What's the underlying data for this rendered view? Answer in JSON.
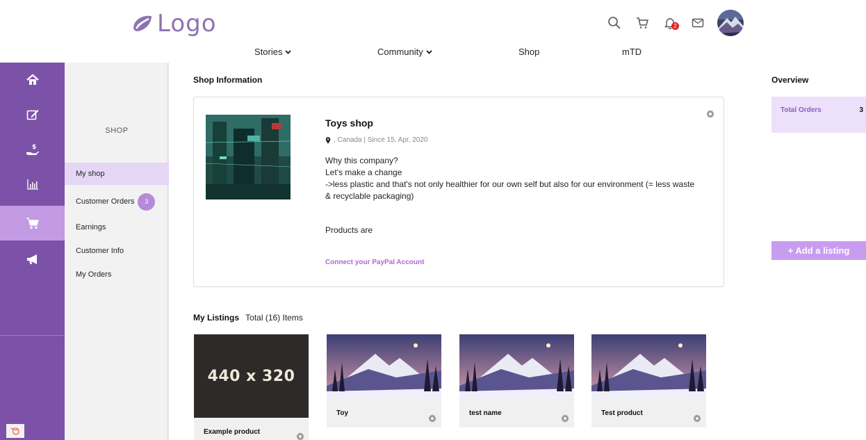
{
  "header": {
    "logo_text": "Logo",
    "notifications_count": "2",
    "icons": [
      "search-icon",
      "cart-icon",
      "bell-icon",
      "mail-icon"
    ]
  },
  "nav": {
    "stories": "Stories",
    "community": "Community",
    "shop": "Shop",
    "mtd": "mTD"
  },
  "rail": {
    "icons": [
      "home-icon",
      "edit-icon",
      "hand-money-icon",
      "chart-icon",
      "cart-icon",
      "megaphone-icon"
    ],
    "active": "cart-icon"
  },
  "sidebar": {
    "title": "SHOP",
    "items": [
      {
        "label": "My shop"
      },
      {
        "label": "Customer Orders",
        "count": "3"
      },
      {
        "label": "Earnings"
      },
      {
        "label": "Customer Info"
      },
      {
        "label": "My Orders"
      }
    ]
  },
  "main": {
    "title": "Shop Information",
    "shop": {
      "name": "Toys shop",
      "location": ", Canada | Since 15, Apr, 2020",
      "desc_1": "Why this company?",
      "desc_2": "Let's make a change",
      "desc_3": "->less plastic and that's not only healthier for our own self but also for our environment (= less waste & recyclable packaging)",
      "products": "Products are",
      "paypal": "Connect your PayPal Account"
    },
    "listings": {
      "title": "My Listings",
      "total": "Total (16) Items",
      "items": [
        {
          "name": "Example product",
          "placeholder": "440 x 320"
        },
        {
          "name": "Toy"
        },
        {
          "name": "test name"
        },
        {
          "name": "Test product"
        }
      ]
    }
  },
  "overview": {
    "title": "Overview",
    "total_orders_label": "Total Orders",
    "total_orders_value": "3",
    "add_listing": "+ Add a listing"
  },
  "colors": {
    "rail": "#7c52a8",
    "rail_active": "#c39ae4",
    "accent": "#b06bd0",
    "add_button": "#c89df0"
  }
}
